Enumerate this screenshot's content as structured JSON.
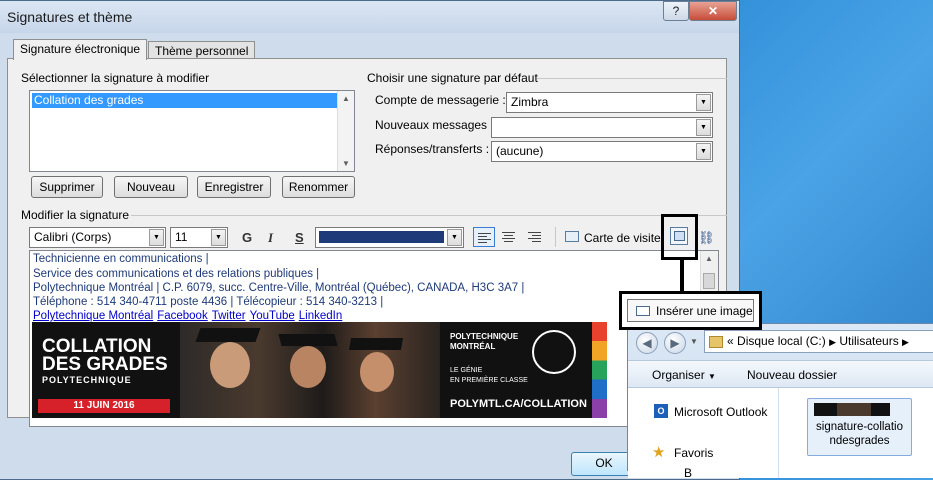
{
  "dialog": {
    "title": "Signatures et thème",
    "help_button": "?",
    "close_button": "✕",
    "tabs": [
      "Signature électronique",
      "Thème personnel"
    ]
  },
  "edit_section": {
    "label": "Sélectionner la signature à modifier",
    "signatures": [
      "Collation des grades"
    ],
    "selected": "Collation des grades",
    "buttons": {
      "delete": "Supprimer",
      "new": "Nouveau",
      "save": "Enregistrer",
      "rename": "Renommer"
    }
  },
  "default_section": {
    "label": "Choisir une signature par défaut",
    "account_label": "Compte de messagerie :",
    "account_value": "Zimbra",
    "new_messages_label": "Nouveaux messages :",
    "new_messages_value": "",
    "replies_label": "Réponses/transferts :",
    "replies_value": "(aucune)"
  },
  "modify_section": {
    "label": "Modifier la signature",
    "font": "Calibri (Corps)",
    "size": "11",
    "bold": "G",
    "italic": "I",
    "underline": "S",
    "font_color": "#1f3a78",
    "business_card": "Carte de visite"
  },
  "signature_text": {
    "line1": "Technicienne en communications  |",
    "line2": "Service des communications et des relations publiques |",
    "line3": "Polytechnique Montréal  |  C.P. 6079, succ. Centre-Ville, Montréal (Québec), CANADA, H3C 3A7  |",
    "line4": "Téléphone : 514 340-4711 poste 4436 |  Télécopieur : 514 340-3213  |",
    "links": [
      "Polytechnique Montréal",
      "Facebook",
      "Twitter",
      "YouTube",
      "LinkedIn"
    ]
  },
  "banner": {
    "title1": "COLLATION",
    "title2": "DES GRADES",
    "sub": "POLYTECHNIQUE",
    "date": "11 JUIN 2016",
    "school1": "POLYTECHNIQUE",
    "school2": "MONTRÉAL",
    "motto1": "LE GÉNIE",
    "motto2": "EN PREMIÈRE CLASSE",
    "url": "POLYMTL.CA/COLLATION"
  },
  "tooltip": {
    "label": "Insérer une image"
  },
  "explorer": {
    "path_prefix": "«",
    "drive": "Disque local (C:)",
    "folder": "Utilisateurs",
    "organize": "Organiser",
    "new_folder": "Nouveau dossier",
    "nav_items": [
      "Microsoft Outlook",
      "Favoris",
      "B"
    ],
    "file_name_1": "signature-collatio",
    "file_name_2": "ndesgrades"
  },
  "ok_button": "OK"
}
